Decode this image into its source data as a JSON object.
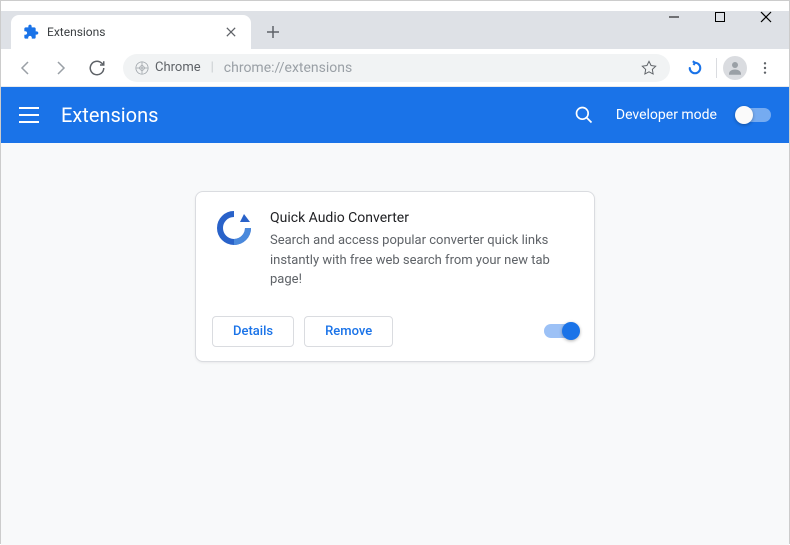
{
  "window": {
    "tab_title": "Extensions"
  },
  "omnibox": {
    "chip": "Chrome",
    "url": "chrome://extensions"
  },
  "page": {
    "title": "Extensions",
    "dev_mode_label": "Developer mode"
  },
  "extension": {
    "name": "Quick Audio Converter",
    "description": "Search and access popular converter quick links instantly with free web search from your new tab page!",
    "details_label": "Details",
    "remove_label": "Remove",
    "enabled": true
  }
}
